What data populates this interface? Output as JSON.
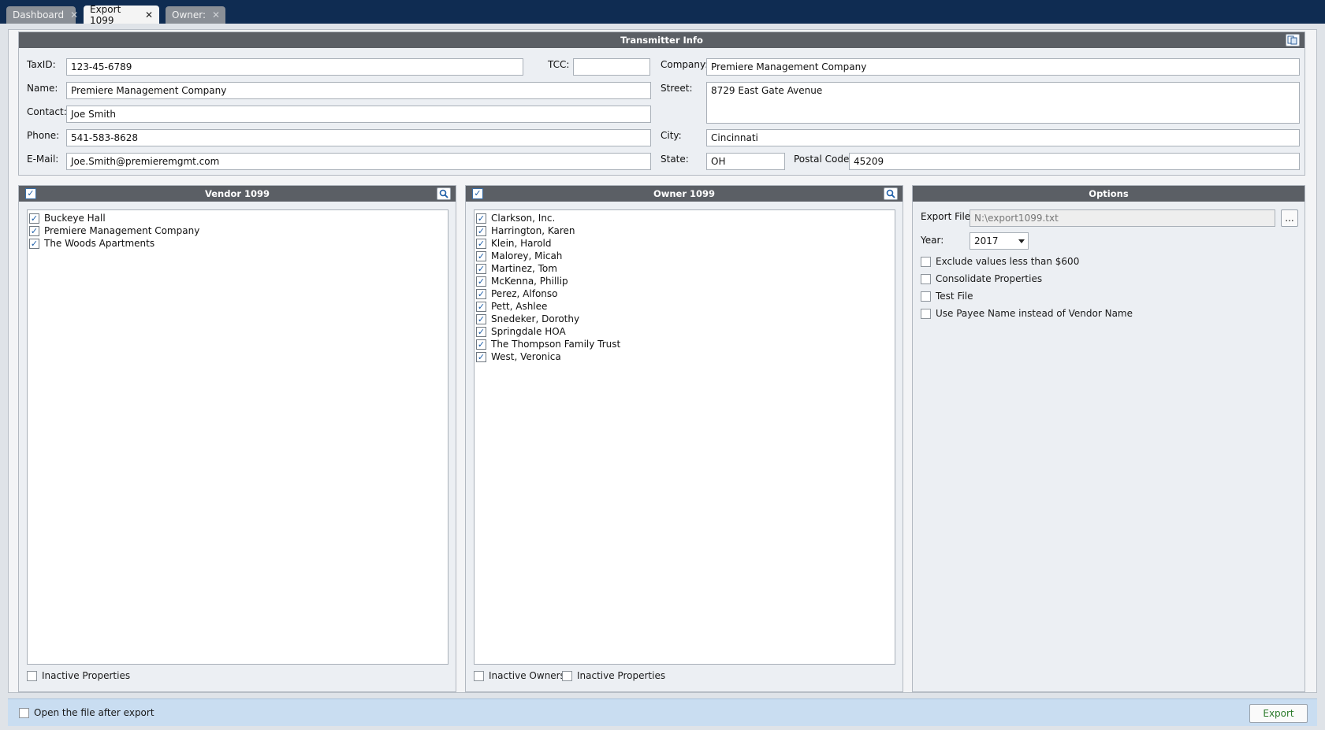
{
  "tabs": [
    {
      "label": "Dashboard"
    },
    {
      "label": "Export 1099"
    },
    {
      "label": "Owner:"
    }
  ],
  "transmitter": {
    "title": "Transmitter Info",
    "taxid_label": "TaxID:",
    "taxid_value": "123-45-6789",
    "tcc_label": "TCC:",
    "tcc_value": "",
    "company_label": "Company:",
    "company_value": "Premiere Management Company",
    "name_label": "Name:",
    "name_value": "Premiere Management Company",
    "street_label": "Street:",
    "street_value": "8729 East Gate Avenue",
    "contact_label": "Contact:",
    "contact_value": "Joe Smith",
    "phone_label": "Phone:",
    "phone_value": "541-583-8628",
    "city_label": "City:",
    "city_value": "Cincinnati",
    "email_label": "E-Mail:",
    "email_value": "Joe.Smith@premieremgmt.com",
    "state_label": "State:",
    "state_value": "OH",
    "postal_label": "Postal Code:",
    "postal_value": "45209"
  },
  "vendor": {
    "title": "Vendor 1099",
    "items": [
      "Buckeye Hall",
      "Premiere Management Company",
      "The Woods Apartments"
    ],
    "inactive_properties_label": "Inactive Properties"
  },
  "owner": {
    "title": "Owner 1099",
    "items": [
      "Clarkson, Inc.",
      "Harrington, Karen",
      "Klein, Harold",
      "Malorey, Micah",
      "Martinez, Tom",
      "McKenna, Phillip",
      "Perez, Alfonso",
      "Pett, Ashlee",
      "Snedeker, Dorothy",
      "Springdale HOA",
      "The Thompson Family Trust",
      "West, Veronica"
    ],
    "inactive_owners_label": "Inactive Owners",
    "inactive_properties_label": "Inactive Properties"
  },
  "options": {
    "title": "Options",
    "export_file_label": "Export File:",
    "export_file_value": "N:\\export1099.txt",
    "browse_label": "...",
    "year_label": "Year:",
    "year_value": "2017",
    "checkboxes": [
      "Exclude values less than $600",
      "Consolidate Properties",
      "Test File",
      "Use Payee Name instead of Vendor Name"
    ]
  },
  "footer": {
    "open_after_label": "Open the file after export",
    "export_button": "Export"
  },
  "colors": {
    "titlebar": "#0f2c52",
    "panel_header": "#5b5f65",
    "footer": "#c9ddf1",
    "export_text": "#2a7a2a"
  }
}
